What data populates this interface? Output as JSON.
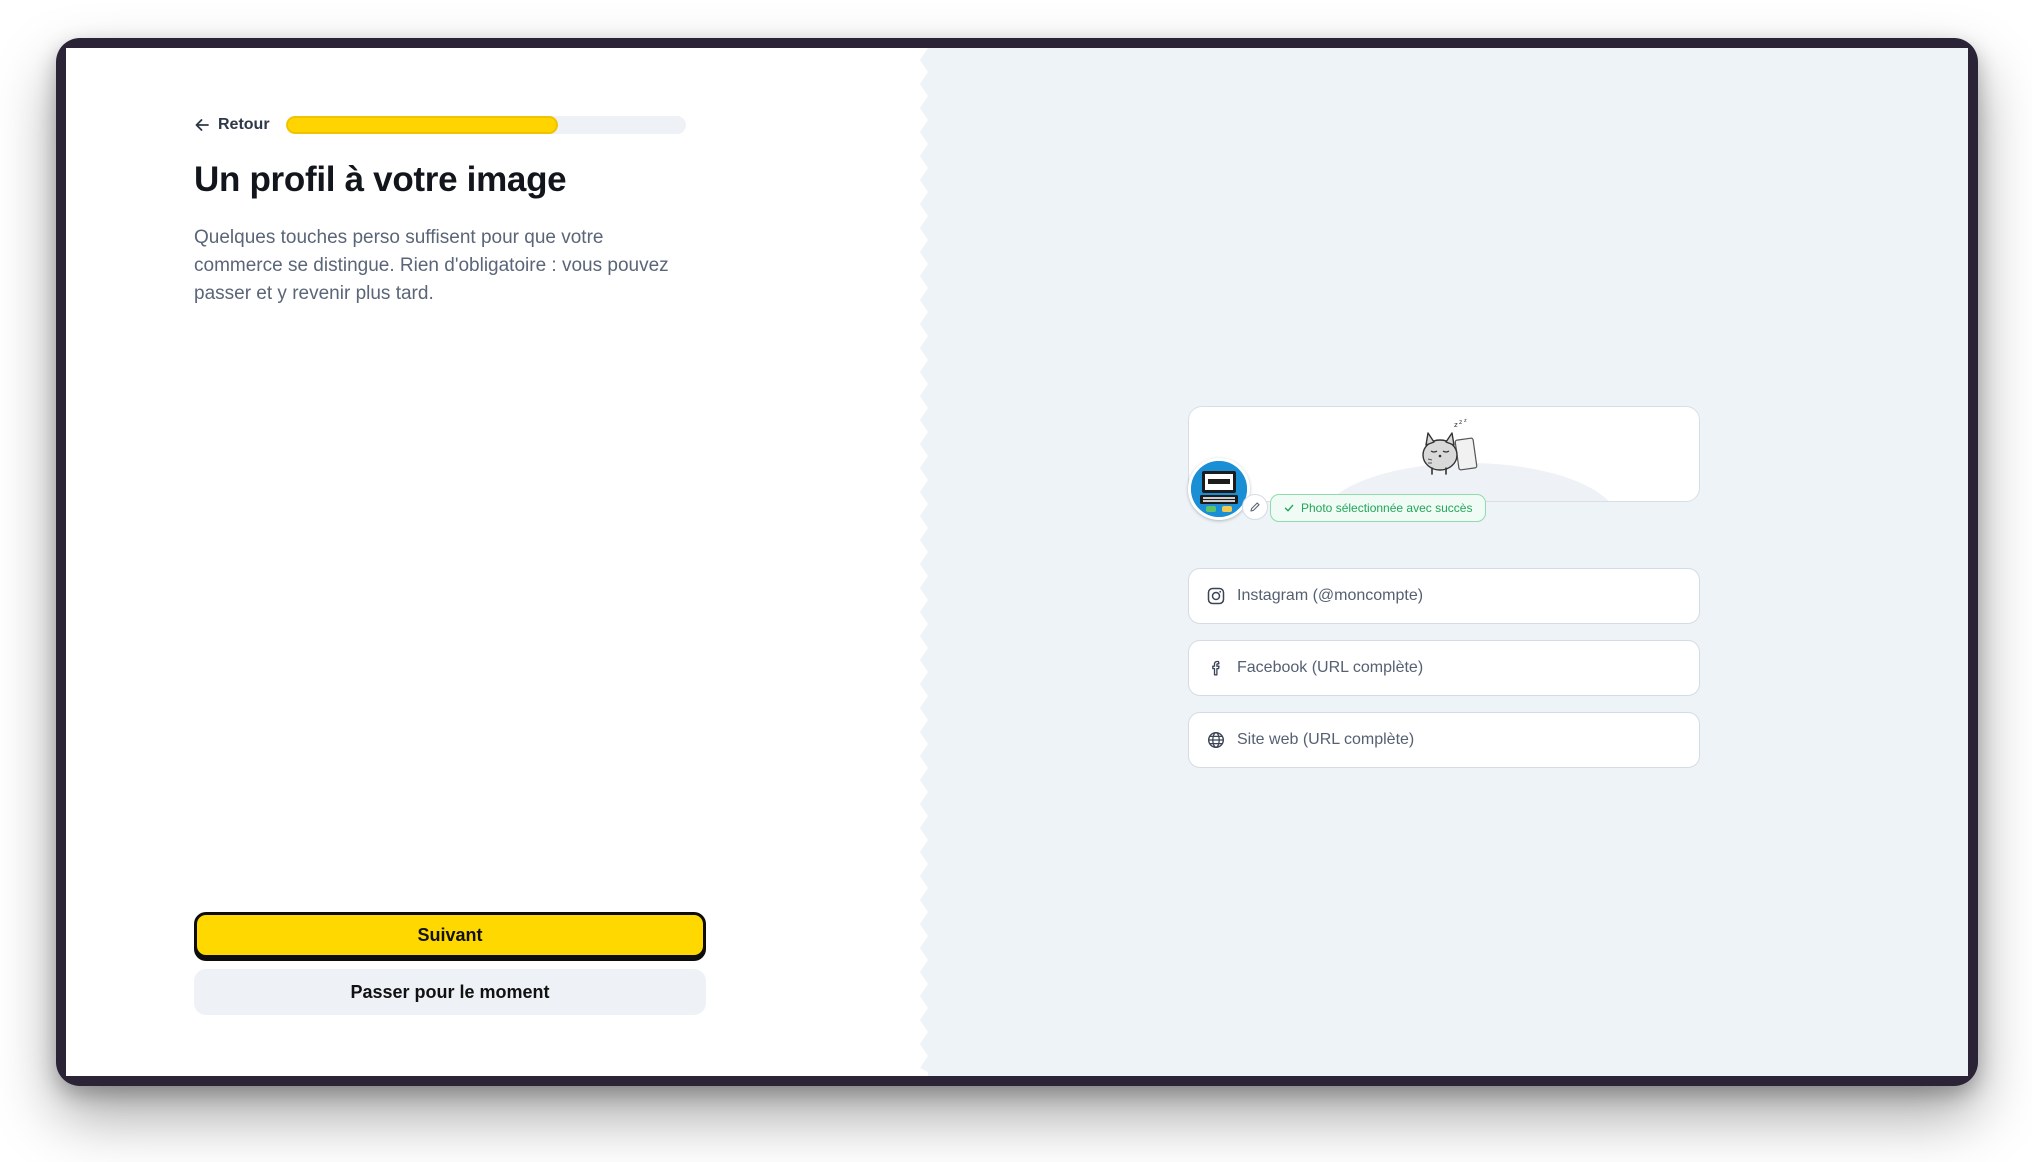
{
  "nav": {
    "back_label": "Retour",
    "progress_fraction": 0.68
  },
  "content": {
    "title": "Un profil à votre image",
    "description": "Quelques touches perso suffisent pour que votre commerce se distingue. Rien d'obligatoire : vous pouvez passer et y revenir plus tard."
  },
  "actions": {
    "primary_label": "Suivant",
    "secondary_label": "Passer pour le moment"
  },
  "preview": {
    "success_message": "Photo sélectionnée avec succès",
    "fields": {
      "instagram_placeholder": "Instagram (@moncompte)",
      "facebook_placeholder": "Facebook (URL complète)",
      "website_placeholder": "Site web (URL complète)"
    },
    "icons": {
      "instagram": "instagram-icon",
      "facebook": "facebook-icon",
      "website": "globe-icon",
      "edit": "pencil-icon",
      "success": "check-icon"
    }
  },
  "colors": {
    "accent": "#ffd800",
    "right_panel_bg": "#eef3f8",
    "success": "#23a55a"
  }
}
